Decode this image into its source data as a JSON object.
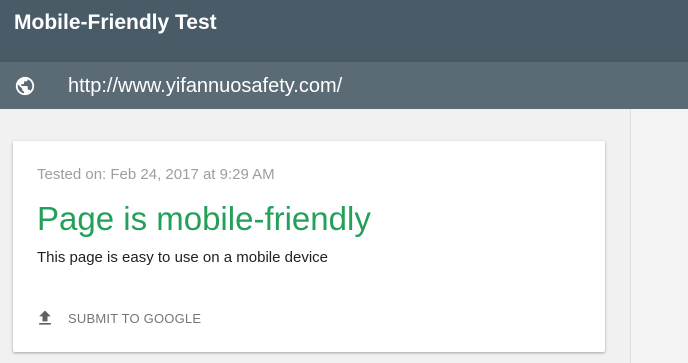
{
  "header": {
    "title": "Mobile-Friendly Test"
  },
  "urlbar": {
    "icon": "globe-icon",
    "url": "http://www.yifannuosafety.com/"
  },
  "result": {
    "tested_on": "Tested on: Feb 24, 2017 at 9:29 AM",
    "title": "Page is mobile-friendly",
    "description": "This page is easy to use on a mobile device",
    "title_color": "#24a05a",
    "submit": {
      "icon": "upload-icon",
      "label": "SUBMIT TO GOOGLE"
    }
  },
  "colors": {
    "header_bg": "#485b66",
    "urlbar_bg": "#5a6b75",
    "accent_green": "#24a05a"
  }
}
